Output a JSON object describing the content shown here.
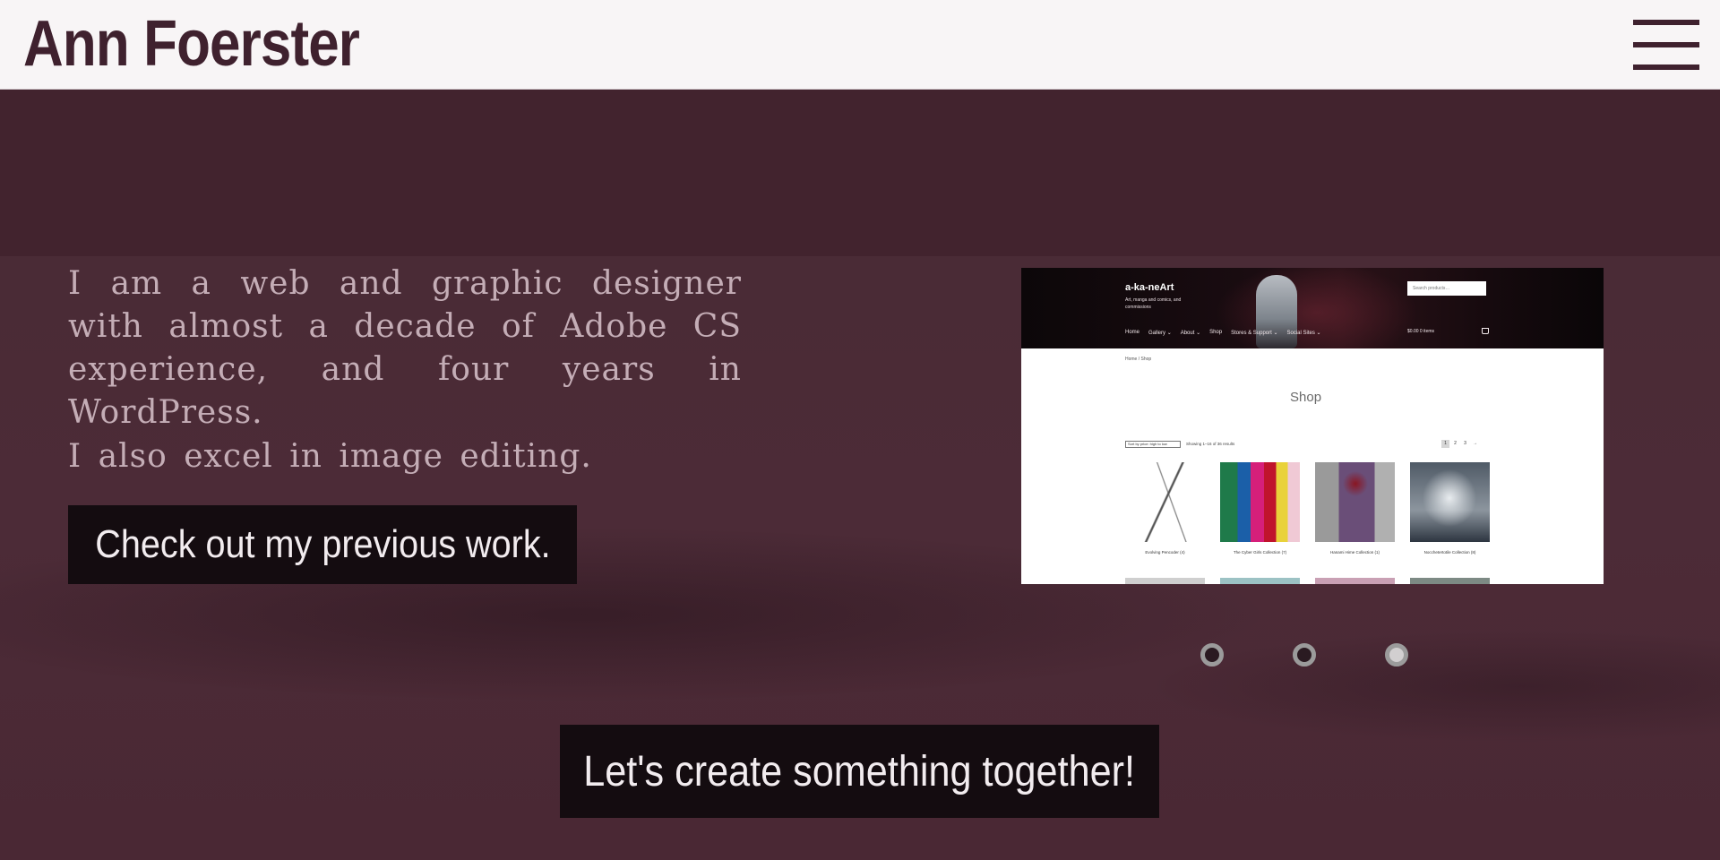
{
  "header": {
    "site_title": "Ann Foerster",
    "menu_icon": "hamburger-menu-icon"
  },
  "intro": {
    "paragraph": "I am a web and graphic designer with almost a decade of Adobe CS experience, and four years in WordPress.",
    "secondary": "I also excel in image editing."
  },
  "buttons": {
    "previous_work": "Check out my previous work.",
    "contact": "Let's create something together!"
  },
  "slider": {
    "slide_count": 3,
    "active_index": 3,
    "screenshot": {
      "brand": "a-ka-neArt",
      "tagline": "Art, manga and comics, and commissions",
      "search_placeholder": "Search products…",
      "nav": [
        "Home",
        "Gallery ⌄",
        "About ⌄",
        "Shop",
        "Stores & Support ⌄",
        "Social Sites ⌄"
      ],
      "cart": "$0.00  0 items",
      "breadcrumb": "Home / Shop",
      "page_title": "Shop",
      "sort_label": "Sort by price: high to low",
      "result_count": "Showing 1–16 of 36 results",
      "pages": [
        "1",
        "2",
        "3",
        "→"
      ],
      "products": [
        "Evolving Pencoder (4)",
        "The Cyber Girls Collection (7)",
        "Hanami Hime Collection (1)",
        "Nocchetertotile Collection (8)"
      ]
    }
  },
  "colors": {
    "header_bg": "#f8f5f6",
    "title": "#3f212e",
    "hero_bg": "#4a2a35",
    "button_bg": "#140c10",
    "button_text": "#f2ecef",
    "body_text": "#c4adb6"
  }
}
